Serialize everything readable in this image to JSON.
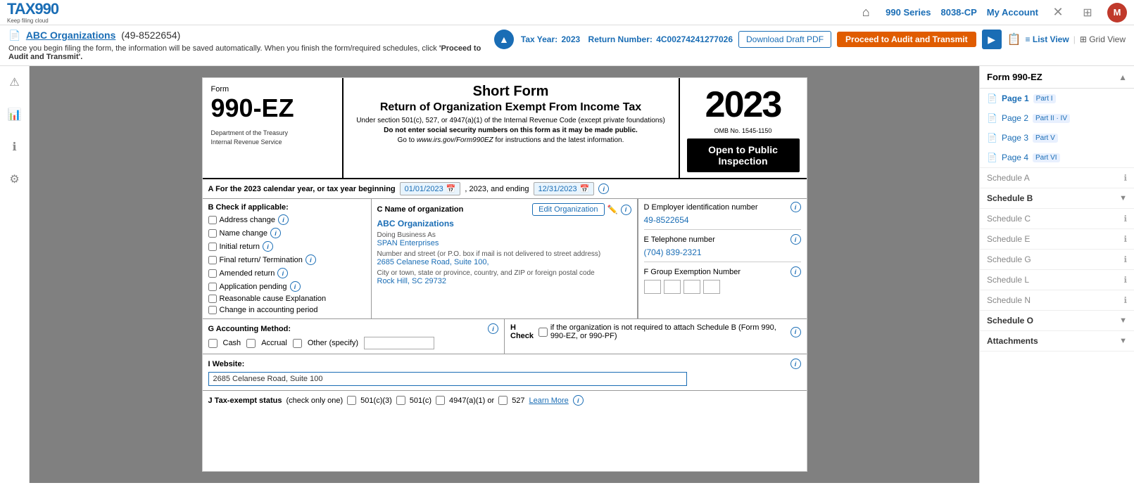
{
  "logo": {
    "main": "TAX990",
    "sub": "Keep filing cloud"
  },
  "topnav": {
    "series_990": "990 Series",
    "8038cp": "8038-CP",
    "my_account": "My Account"
  },
  "header": {
    "org_name": "ABC Organizations",
    "ein": "(49-8522654)",
    "link": "ABC Organizations",
    "autosave": "Once you begin filing the form, the information will be saved automatically. When you finish the form/required schedules, click",
    "autosave_bold": "'Proceed to Audit and Transmit'.",
    "tax_year_label": "Tax Year:",
    "tax_year": "2023",
    "return_label": "Return Number:",
    "return_number": "4C00274241277026",
    "download_draft": "Download Draft PDF",
    "proceed": "Proceed to Audit and Transmit"
  },
  "form": {
    "form_label": "Form",
    "form_number": "990-EZ",
    "title": "Short Form",
    "subtitle": "Return of Organization Exempt From Income Tax",
    "desc1": "Under section 501(c), 527, or 4947(a)(1) of the Internal Revenue Code (except private foundations)",
    "desc2": "Do not enter social security numbers on this form as it may be made public.",
    "desc3": "Go to www.irs.gov/Form990EZ for instructions and the latest information.",
    "dept1": "Department of the Treasury",
    "dept2": "Internal Revenue Service",
    "year": "2023",
    "omb": "OMB No. 1545-1150",
    "open_inspection": "Open to Public Inspection",
    "section_a_label": "A For the 2023 calendar year, or tax year beginning",
    "start_date": "01/01/2023",
    "mid_text": ", 2023, and ending",
    "end_date": "12/31/2023",
    "section_b_label": "B Check if applicable:",
    "checkboxes": [
      {
        "id": "address_change",
        "label": "Address change",
        "checked": false
      },
      {
        "id": "name_change",
        "label": "Name change",
        "checked": false
      },
      {
        "id": "initial_return",
        "label": "Initial return",
        "checked": false
      },
      {
        "id": "final_return",
        "label": "Final return/ Termination",
        "checked": false
      },
      {
        "id": "amended_return",
        "label": "Amended return",
        "checked": false
      },
      {
        "id": "application_pending",
        "label": "Application pending",
        "checked": false
      },
      {
        "id": "reasonable_cause",
        "label": "Reasonable cause Explanation",
        "checked": false
      },
      {
        "id": "change_accounting",
        "label": "Change in accounting period",
        "checked": false
      }
    ],
    "section_c_label": "C Name of organization",
    "edit_org": "Edit Organization",
    "org_name": "ABC Organizations",
    "dba_label": "Doing Business As",
    "dba_name": "SPAN Enterprises",
    "addr_label": "Number and street (or P.O. box if mail is not delivered to street address)",
    "addr_value": "2685 Celanese Road, Suite 100,",
    "city_label": "City or town, state or province, country, and ZIP or foreign postal code",
    "city_value": "Rock Hill, SC 29732",
    "section_d_label": "D Employer identification number",
    "ein_value": "49-8522654",
    "section_e_label": "E Telephone number",
    "phone_value": "(704) 839-2321",
    "section_f_label": "F Group Exemption Number",
    "section_g_label": "G Accounting Method:",
    "accounting_cash": "Cash",
    "accounting_accrual": "Accrual",
    "accounting_other": "Other (specify)",
    "section_h_label": "H Check",
    "section_h_text": "if the organization is not required to attach Schedule B (Form 990, 990-EZ, or 990-PF)",
    "section_i_label": "I Website:",
    "website_value": "2685 Celanese Road, Suite 100",
    "section_j_label": "J Tax-exempt status",
    "section_j_note": "(check only one)",
    "section_j_options": [
      "501(c)(3)",
      "501(c)",
      "4947(a)(1) or",
      "527"
    ],
    "learn_more": "Learn More"
  },
  "right_sidebar": {
    "title": "Form 990-EZ",
    "pages": [
      {
        "label": "Page 1",
        "badge": "Part I",
        "active": true
      },
      {
        "label": "Page 2",
        "badge": "Part II · IV"
      },
      {
        "label": "Page 3",
        "badge": "Part V"
      },
      {
        "label": "Page 4",
        "badge": "Part VI"
      }
    ],
    "schedule_a": "Schedule A",
    "schedule_b": "Schedule B",
    "schedule_c": "Schedule C",
    "schedule_e": "Schedule E",
    "schedule_g": "Schedule G",
    "schedule_l": "Schedule L",
    "schedule_n": "Schedule N",
    "schedule_o": "Schedule O",
    "attachments": "Attachments"
  }
}
